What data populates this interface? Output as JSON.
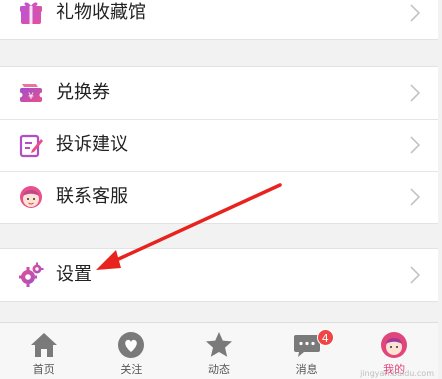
{
  "menu": {
    "gift_label": "礼物收藏馆",
    "coupon_label": "兑换券",
    "feedback_label": "投诉建议",
    "service_label": "联系客服",
    "settings_label": "设置"
  },
  "tabbar": {
    "home_label": "首页",
    "follow_label": "关注",
    "feed_label": "动态",
    "messages_label": "消息",
    "messages_badge": "4",
    "mine_label": "我的"
  },
  "watermark": "jingyan.baidu.com",
  "colors": {
    "accent": "#e2457a",
    "icon_purple": "#a04fd0",
    "icon_pink": "#e7508a",
    "tab_gray": "#777777",
    "badge_red": "#f04545",
    "arrow_red": "#e8231e"
  },
  "icons": {
    "gift": "gift-icon",
    "coupon": "coupon-icon",
    "feedback": "pen-note-icon",
    "service": "avatar-headset-icon",
    "settings": "gear-icon",
    "chevron": "chevron-right-icon",
    "home": "home-icon",
    "follow": "heart-icon",
    "feed": "star-icon",
    "messages": "chat-bubble-icon",
    "mine": "user-avatar-icon"
  }
}
